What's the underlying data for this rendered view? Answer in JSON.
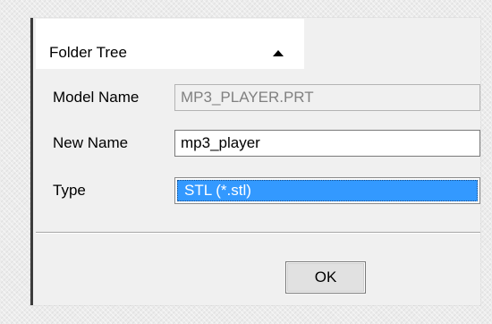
{
  "dialog": {
    "folder_tree": {
      "label": "Folder Tree",
      "toggle_icon": "triangle-up-icon"
    },
    "model_name": {
      "label": "Model Name",
      "value": "MP3_PLAYER.PRT"
    },
    "new_name": {
      "label": "New Name",
      "value": "mp3_player"
    },
    "type": {
      "label": "Type",
      "selected": "STL (*.stl)"
    },
    "ok_label": "OK"
  },
  "colors": {
    "selection": "#3399ff",
    "dialog_background": "#f0f0f0",
    "disabled_text": "#808080"
  }
}
